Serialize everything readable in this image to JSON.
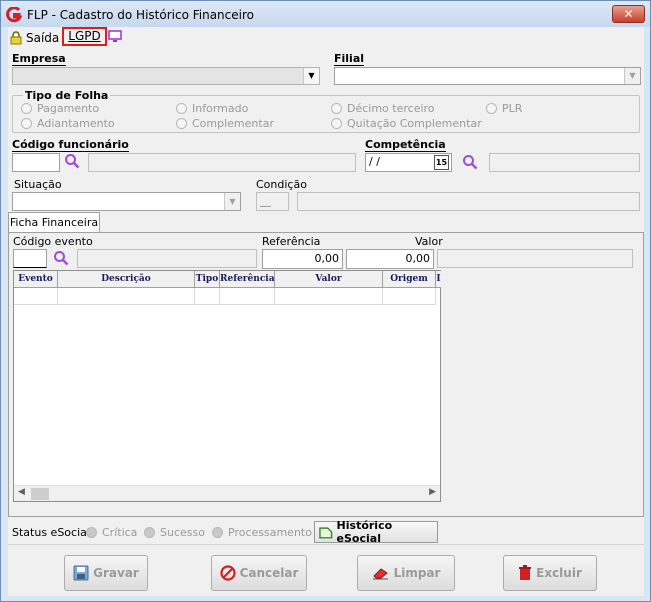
{
  "window": {
    "title": "FLP - Cadastro do Histórico Financeiro",
    "close_label": "✕"
  },
  "menu": {
    "saida": "Saída",
    "lgpd": "LGPD"
  },
  "labels": {
    "empresa": "Empresa",
    "filial": "Filial",
    "tipo_de_folha": "Tipo de Folha",
    "codigo_funcionario": "Código funcionário",
    "competencia": "Competência",
    "situacao": "Situação",
    "condicao": "Condição",
    "codigo_evento": "Código evento",
    "referencia": "Referência",
    "valor": "Valor"
  },
  "radios": {
    "pagamento": "Pagamento",
    "informado": "Informado",
    "decimo_terceiro": "Décimo terceiro",
    "plr": "PLR",
    "adiantamento": "Adiantamento",
    "complementar": "Complementar",
    "quitacao_complementar": "Quitação Complementar"
  },
  "fields": {
    "competencia_value": " / /",
    "calendar_label": "15",
    "condicao_value": "__",
    "referencia_value": "0,00",
    "valor_value": "0,00"
  },
  "tabs": {
    "ficha_financeira": "Ficha Financeira"
  },
  "grid": {
    "columns": [
      "Evento",
      "Descrição",
      "Tipo",
      "Referência",
      "Valor",
      "Origem",
      "I"
    ]
  },
  "status": {
    "label": "Status eSocial:",
    "critica": "Crítica",
    "sucesso": "Sucesso",
    "processamento": "Processamento",
    "historico_button": "Histórico eSocial"
  },
  "buttons": {
    "gravar": "Gravar",
    "cancelar": "Cancelar",
    "limpar": "Limpar",
    "excluir": "Excluir"
  },
  "colors": {
    "accent_red": "#e11c1c",
    "search_purple": "#9b4fd6"
  }
}
